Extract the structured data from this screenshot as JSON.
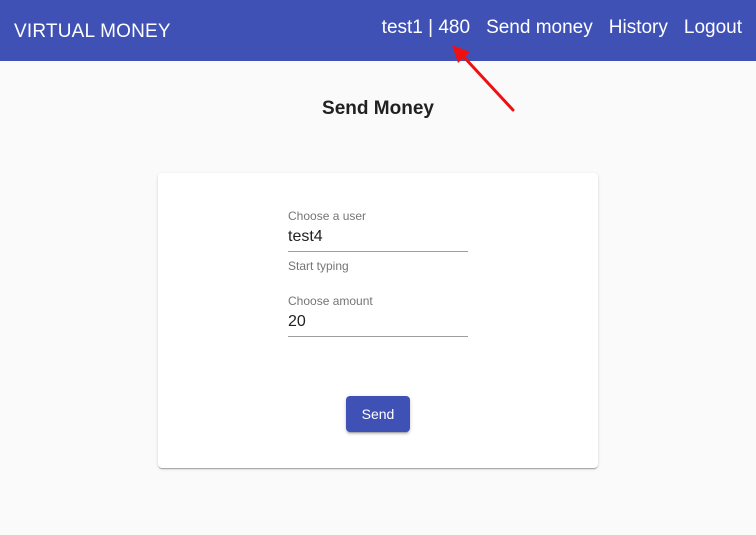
{
  "header": {
    "brand": "VIRTUAL MONEY",
    "user_balance": "test1 | 480",
    "nav": {
      "send_money": "Send money",
      "history": "History",
      "logout": "Logout"
    }
  },
  "main": {
    "title": "Send Money",
    "form": {
      "user_field": {
        "label": "Choose a user",
        "value": "test4",
        "hint": "Start typing"
      },
      "amount_field": {
        "label": "Choose amount",
        "value": "20"
      },
      "send_label": "Send"
    }
  },
  "colors": {
    "primary": "#3f51b5",
    "annotation_arrow": "#ee1111"
  }
}
